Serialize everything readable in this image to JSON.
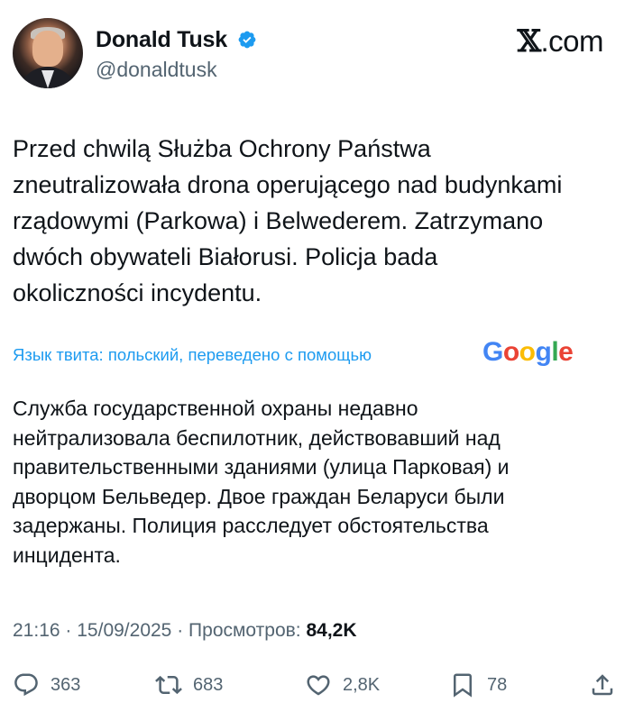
{
  "header": {
    "name": "Donald Tusk",
    "handle": "@donaldtusk",
    "brand_x": "𝕏",
    "brand_suffix": ".com"
  },
  "tweet": {
    "text": "Przed chwilą Służba Ochrony Państwa\nzneutralizowała drona operującego nad budynkami\nrządowymi (Parkowa) i Belwederem. Zatrzymano\ndwóch obywateli Białorusi. Policja bada\nokoliczności incydentu."
  },
  "translation": {
    "note": "Язык твита: польский, переведено с помощью",
    "provider_letters": [
      "G",
      "o",
      "o",
      "g",
      "l",
      "e"
    ],
    "provider_colors": [
      "#4285F4",
      "#EA4335",
      "#FBBC05",
      "#4285F4",
      "#34A853",
      "#EA4335"
    ],
    "text": "Служба государственной охраны недавно\nнейтрализовала беспилотник, действовавший над\nправительственными зданиями (улица Парковая) и\nдворцом Бельведер. Двое граждан Беларуси были\nзадержаны. Полиция расследует обстоятельства\nинцидента."
  },
  "meta": {
    "time": "21:16",
    "date": "15/09/2025",
    "separator": "·",
    "views_label": "Просмотров:",
    "views_count": "84,2K"
  },
  "actions": {
    "replies": "363",
    "reposts": "683",
    "likes": "2,8K",
    "bookmarks": "78"
  },
  "colors": {
    "accent": "#1d9bf0",
    "muted": "#536471",
    "text": "#0f1419"
  }
}
